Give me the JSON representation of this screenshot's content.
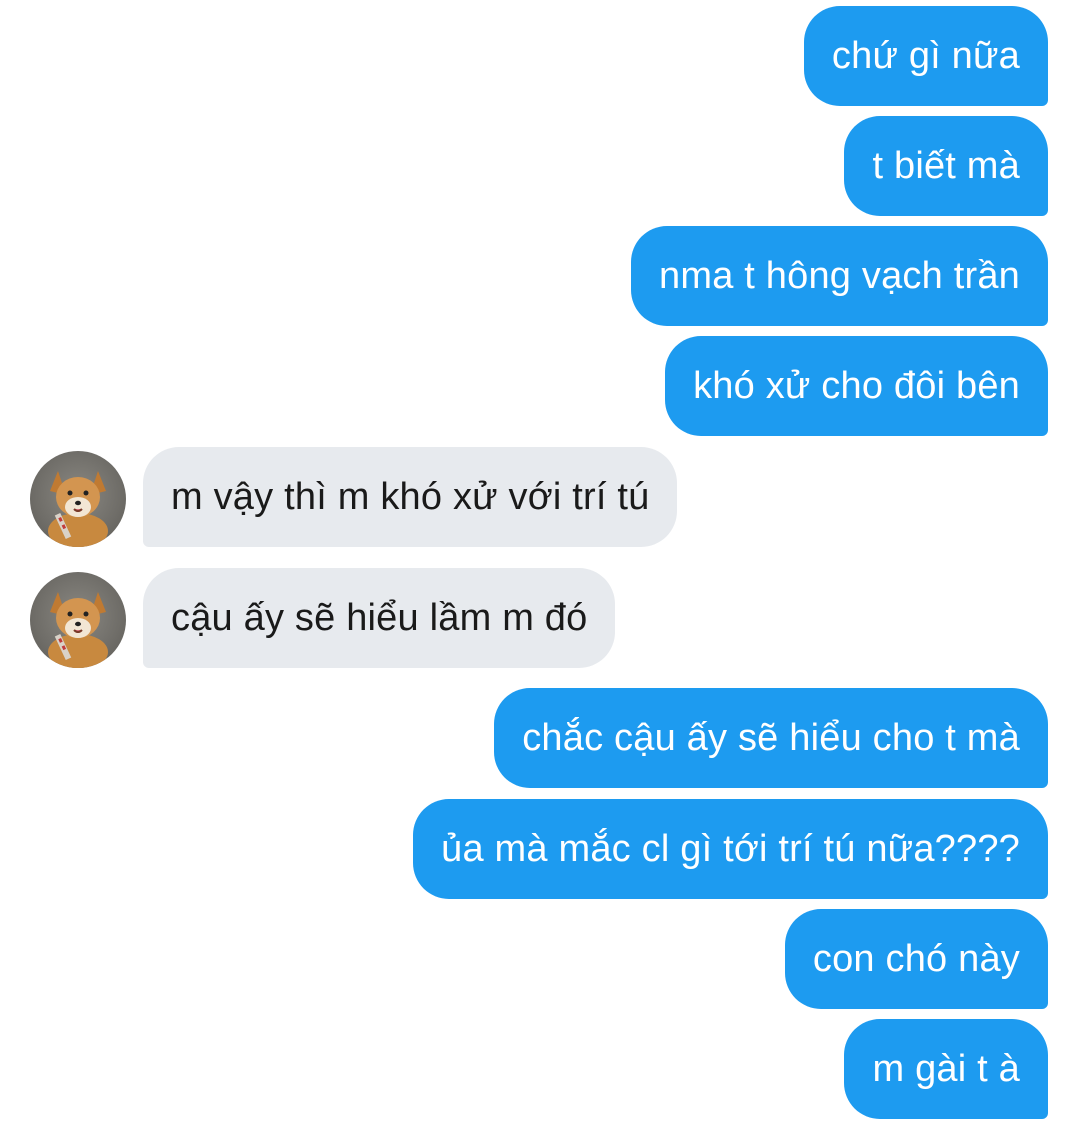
{
  "conversation": {
    "messages": [
      {
        "direction": "outgoing",
        "text": "chứ gì nữa"
      },
      {
        "direction": "outgoing",
        "text": "t biết mà"
      },
      {
        "direction": "outgoing",
        "text": "nma t hông vạch trần"
      },
      {
        "direction": "outgoing",
        "text": "khó xử cho đôi bên"
      },
      {
        "direction": "incoming",
        "text": "m vậy thì m khó xử với trí tú",
        "avatar_icon": "shiba-dog-avatar-icon"
      },
      {
        "direction": "incoming",
        "text": "cậu ấy sẽ hiểu lầm m đó",
        "avatar_icon": "shiba-dog-avatar-icon"
      },
      {
        "direction": "outgoing",
        "text": "chắc cậu ấy sẽ hiểu cho t mà"
      },
      {
        "direction": "outgoing",
        "text": "ủa mà mắc cl gì tới trí tú nữa????"
      },
      {
        "direction": "outgoing",
        "text": "con chó này"
      },
      {
        "direction": "outgoing",
        "text": "m gài t à"
      }
    ]
  },
  "colors": {
    "outgoing_bubble": "#1d9bf0",
    "outgoing_text": "#ffffff",
    "incoming_bubble": "#e7eaee",
    "incoming_text": "#1a1a1a",
    "background": "#ffffff"
  }
}
